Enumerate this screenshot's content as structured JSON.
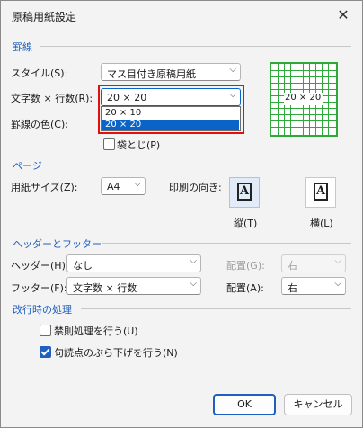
{
  "window": {
    "title": "原稿用紙設定",
    "close_glyph": "✕"
  },
  "ruled": {
    "section": "罫線",
    "style_label": "スタイル(S):",
    "style_value": "マス目付き原稿用紙",
    "grid_label": "文字数 × 行数(R):",
    "grid_value": "20 × 20",
    "grid_options": [
      "20 × 10",
      "20 × 20"
    ],
    "grid_selected_index": 1,
    "color_label": "罫線の色(C):",
    "fold_label": "袋とじ(P)",
    "preview_label": "20 × 20"
  },
  "page": {
    "section": "ページ",
    "size_label": "用紙サイズ(Z):",
    "size_value": "A4",
    "orient_label": "印刷の向き:",
    "portrait_label": "縦(T)",
    "landscape_label": "横(L)",
    "orient_glyph": "A"
  },
  "header_footer": {
    "section": "ヘッダーとフッター",
    "header_label": "ヘッダー(H):",
    "header_value": "なし",
    "header_align_label": "配置(G):",
    "header_align_value": "右",
    "footer_label": "フッター(F):",
    "footer_value": "文字数 × 行数",
    "footer_align_label": "配置(A):",
    "footer_align_value": "右"
  },
  "linebreak": {
    "section": "改行時の処理",
    "kinsoku_label": "禁則処理を行う(U)",
    "kinsoku_checked": false,
    "burasage_label": "句読点のぶら下げを行う(N)",
    "burasage_checked": true
  },
  "buttons": {
    "ok": "OK",
    "cancel": "キャンセル"
  },
  "colors": {
    "accent": "#1f5fbf",
    "highlight": "#e01010",
    "grid": "#2fa83a",
    "selection": "#0a64c8"
  },
  "icons": {
    "dropdown": "chevron-down-icon",
    "close": "close-icon"
  }
}
